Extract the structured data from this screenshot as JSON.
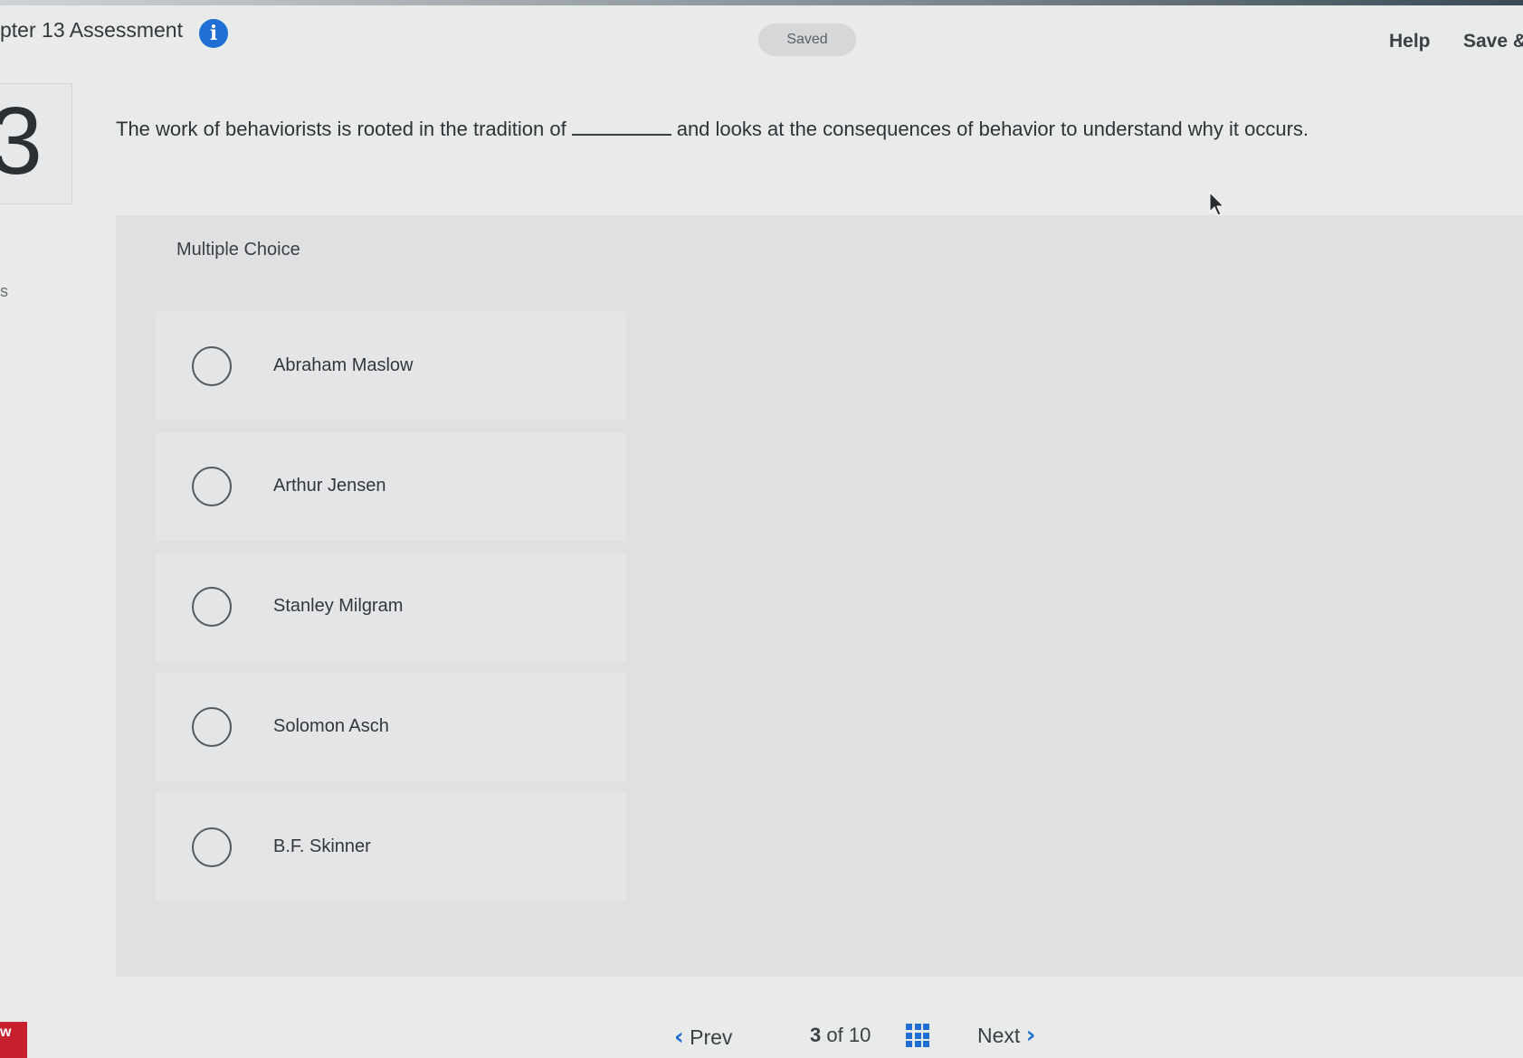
{
  "header": {
    "title": "pter 13 Assessment",
    "info_icon": "info-icon",
    "saved_status": "Saved",
    "help_label": "Help",
    "save_exit_label": "Save &"
  },
  "question": {
    "number": "3",
    "text_before_blank": "The work of behaviorists is rooted in the tradition of",
    "text_after_blank": "and looks at the consequences of behavior to understand why it occurs.",
    "type_label": "Multiple Choice",
    "options": [
      {
        "label": "Abraham Maslow",
        "selected": false
      },
      {
        "label": "Arthur Jensen",
        "selected": false
      },
      {
        "label": "Stanley Milgram",
        "selected": false
      },
      {
        "label": "Solomon Asch",
        "selected": false
      },
      {
        "label": "B.F. Skinner",
        "selected": false
      }
    ]
  },
  "sidebar": {
    "partial_letter": "s"
  },
  "footer": {
    "brand_text": "w",
    "prev_label": "Prev",
    "current_page": "3",
    "of_label": "of",
    "total_pages": "10",
    "next_label": "Next"
  },
  "colors": {
    "accent": "#1f6ed4",
    "brand": "#c8202f",
    "background": "#e9eaea"
  }
}
